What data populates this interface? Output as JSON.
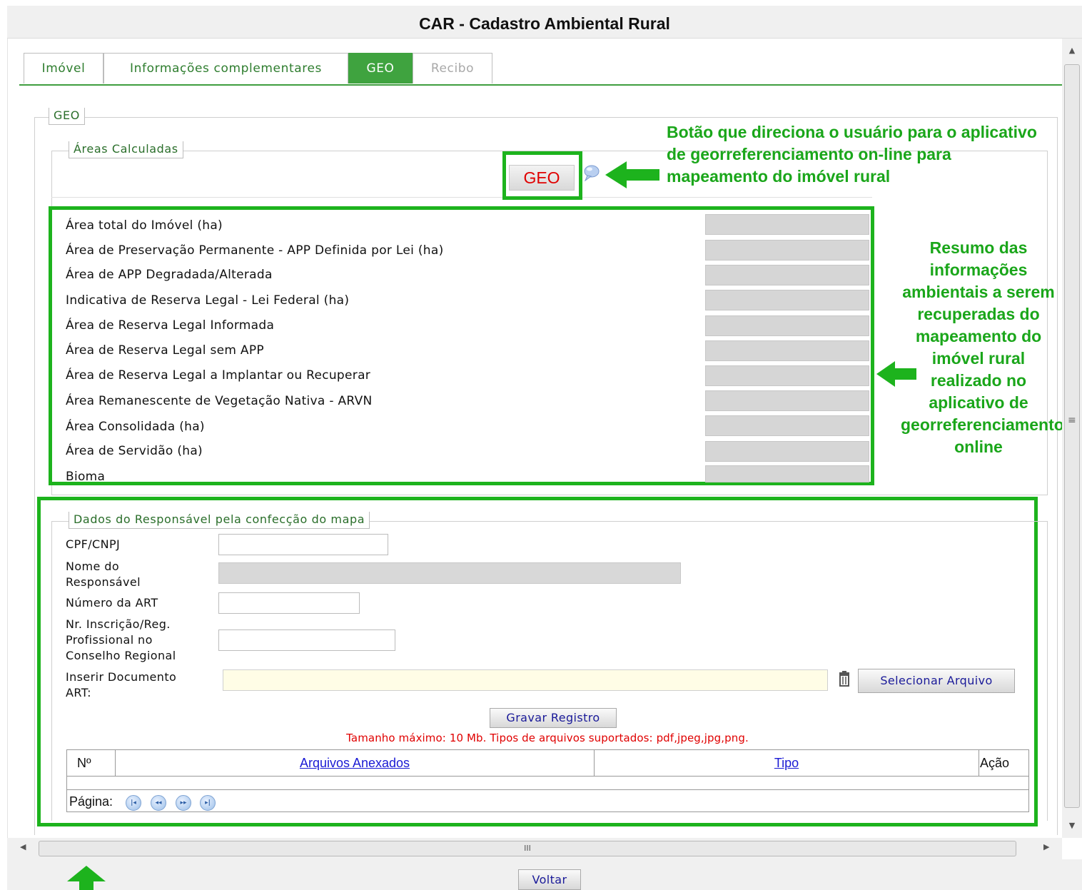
{
  "window": {
    "title": "CAR - Cadastro Ambiental Rural"
  },
  "tabs": [
    {
      "label": "Imóvel",
      "state": "normal"
    },
    {
      "label": "Informações complementares",
      "state": "normal"
    },
    {
      "label": "GEO",
      "state": "active"
    },
    {
      "label": "Recibo",
      "state": "disabled"
    }
  ],
  "geo_section": {
    "legend": "GEO",
    "areas_legend": "Áreas Calculadas",
    "geo_button": "GEO",
    "help_icon": "speech-bubble-icon",
    "rows": [
      {
        "label": "Área total do Imóvel (ha)",
        "value": ""
      },
      {
        "label": "Área de Preservação Permanente - APP Definida por Lei (ha)",
        "value": ""
      },
      {
        "label": "Área de APP Degradada/Alterada",
        "value": ""
      },
      {
        "label": "Indicativa de Reserva Legal - Lei Federal (ha)",
        "value": ""
      },
      {
        "label": "Área de Reserva Legal Informada",
        "value": ""
      },
      {
        "label": "Área de Reserva Legal sem APP",
        "value": ""
      },
      {
        "label": "Área de Reserva Legal a Implantar ou Recuperar",
        "value": ""
      },
      {
        "label": "Área Remanescente de Vegetação Nativa - ARVN",
        "value": ""
      },
      {
        "label": "Área Consolidada (ha)",
        "value": ""
      },
      {
        "label": "Área de Servidão (ha)",
        "value": ""
      },
      {
        "label": "Bioma",
        "value": ""
      }
    ]
  },
  "callouts": {
    "geo_button": "Botão que direciona o usuário para o aplicativo de georreferenciamento on-line para mapeamento do imóvel rural",
    "summary": "Resumo das informações ambientais a serem recuperadas do mapeamento do imóvel rural realizado no aplicativo de georreferenciamento online"
  },
  "responsavel": {
    "legend": "Dados do Responsável pela confecção do mapa",
    "cpf_label": "CPF/CNPJ",
    "cpf_value": "",
    "nome_label": "Nome do Responsável",
    "nome_value": "",
    "art_label": "Número da ART",
    "art_value": "",
    "inscricao_label": "Nr. Inscrição/Reg. Profissional no Conselho Regional",
    "inscricao_value": "",
    "doc_label": "Inserir Documento ART:",
    "doc_value": "",
    "delete_icon": "trash-icon",
    "select_file_button": "Selecionar Arquivo",
    "save_button": "Gravar Registro",
    "note": "Tamanho máximo: 10 Mb. Tipos de arquivos suportados: pdf,jpeg,jpg,png."
  },
  "grid": {
    "columns": [
      "Nº",
      "Arquivos Anexados",
      "Tipo",
      "Ação"
    ],
    "pager_label": "Página:",
    "pager_icons": [
      "first-page-icon",
      "previous-page-icon",
      "next-page-icon",
      "last-page-icon"
    ]
  },
  "scrollbar": {
    "grip": "III"
  },
  "footer": {
    "back_button": "Voltar"
  },
  "colors": {
    "accent": "#3fa33f",
    "annotation": "#1db31d",
    "error": "#e00000"
  }
}
